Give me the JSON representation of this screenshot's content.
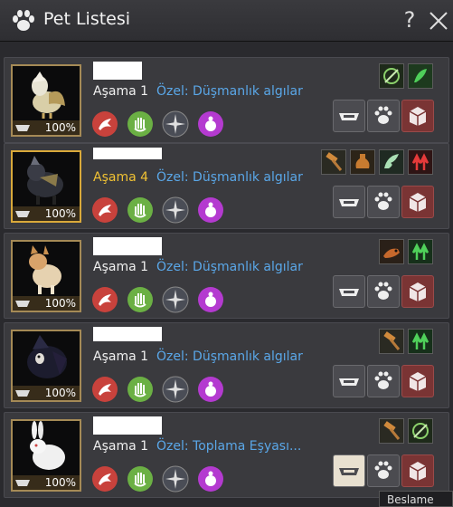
{
  "window": {
    "title": "Pet Listesi",
    "help_label": "?"
  },
  "pets": [
    {
      "stage_label": "Aşama",
      "stage_value": "1",
      "special": "Özel: Düşmanlık algılar",
      "hunger": "100%",
      "highlight": false,
      "traits": [
        "crosshair-icon",
        "green-grow-icon"
      ]
    },
    {
      "stage_label": "Aşama",
      "stage_value": "4",
      "special": "Özel: Düşmanlık algılar",
      "hunger": "100%",
      "highlight": true,
      "traits": [
        "hammer-icon",
        "potion-icon",
        "wing-icon",
        "red-arrows-icon"
      ]
    },
    {
      "stage_label": "Aşama",
      "stage_value": "1",
      "special": "Özel: Düşmanlık algılar",
      "hunger": "100%",
      "highlight": false,
      "traits": [
        "fox-icon",
        "green-arrows-icon"
      ]
    },
    {
      "stage_label": "Aşama",
      "stage_value": "1",
      "special": "Özel: Düşmanlık algılar",
      "hunger": "100%",
      "highlight": false,
      "traits": [
        "hammer-icon",
        "green-arrows-icon"
      ]
    },
    {
      "stage_label": "Aşama",
      "stage_value": "1",
      "special": "Özel: Toplama Eşyası...",
      "hunger": "100%",
      "highlight": false,
      "traits": [
        "hammer-icon",
        "crosshair-icon"
      ]
    }
  ],
  "bottom_tip": "Beslame",
  "colors": {
    "accent_blue": "#5aa7e8",
    "gold": "#f1c233"
  }
}
